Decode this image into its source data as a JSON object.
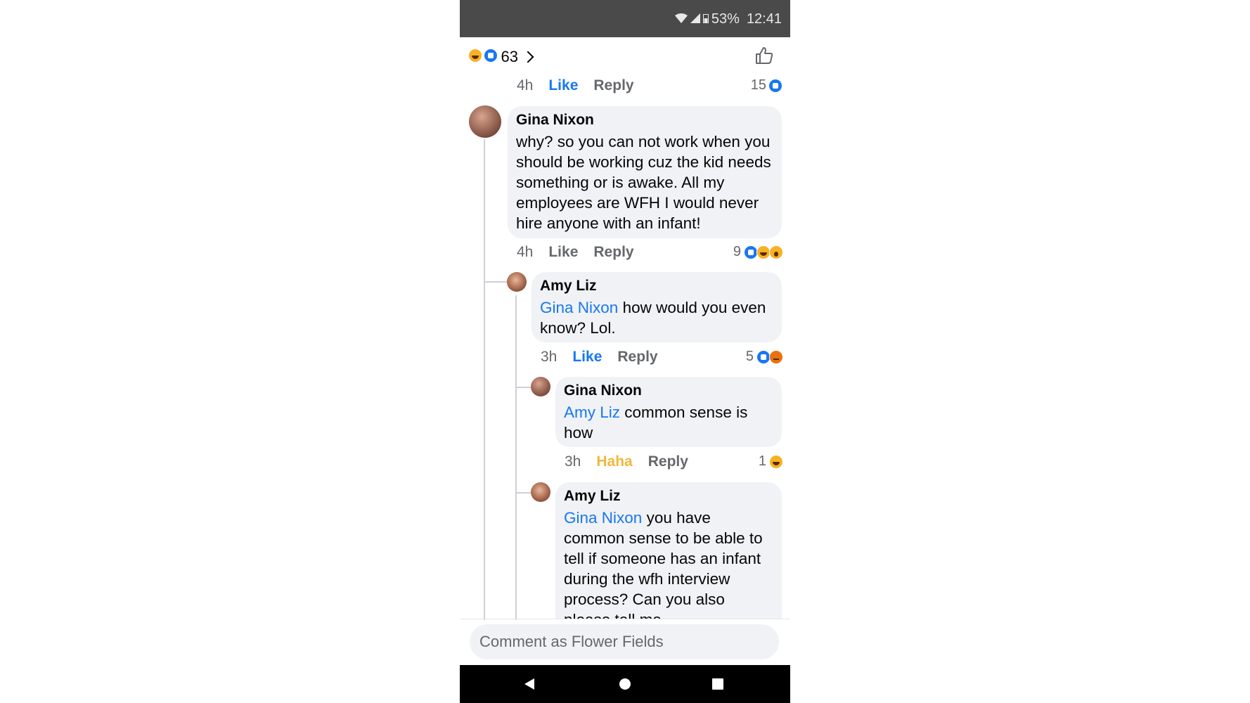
{
  "status_bar": {
    "battery": "53%",
    "time": "12:41"
  },
  "header": {
    "reaction_count": "63",
    "reaction_icons": [
      "haha-icon",
      "like-icon"
    ]
  },
  "top_meta": {
    "time": "4h",
    "like": "Like",
    "reply": "Reply",
    "count": "15"
  },
  "comments": [
    {
      "author": "Gina Nixon",
      "text": "why? so you can not work when you should be working cuz the kid needs something or is awake. All my employees are WFH I would never hire anyone with an infant!",
      "time": "4h",
      "like": "Like",
      "reply": "Reply",
      "count": "9"
    },
    {
      "author": "Amy Liz",
      "mention": "Gina Nixon",
      "text": " how would you even know? Lol.",
      "time": "3h",
      "like": "Like",
      "reply": "Reply",
      "count": "5"
    },
    {
      "author": "Gina Nixon",
      "mention": "Amy Liz",
      "text": " common sense is how",
      "time": "3h",
      "like": "Haha",
      "reply": "Reply",
      "count": "1"
    },
    {
      "author": "Amy Liz",
      "mention": "Gina Nixon",
      "text": " you have common sense to be able to tell if someone has an infant during the wfh interview process? Can you also please tell me"
    }
  ],
  "comment_box": {
    "placeholder": "Comment as Flower Fields"
  },
  "colors": {
    "brand_blue": "#1877f2",
    "haha_yellow": "#f0b83c",
    "bubble_bg": "#f0f2f5",
    "muted": "#65676b"
  }
}
